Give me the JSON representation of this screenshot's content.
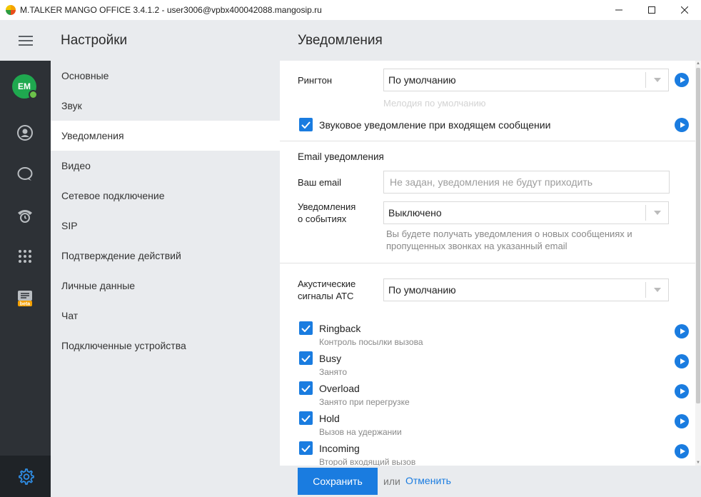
{
  "window": {
    "title": "M.TALKER MANGO OFFICE 3.4.1.2 - user3006@vpbx400042088.mangosip.ru"
  },
  "rail": {
    "avatar_initials": "EM",
    "beta_badge": "beta"
  },
  "nav": {
    "title": "Настройки",
    "items": [
      {
        "label": "Основные"
      },
      {
        "label": "Звук"
      },
      {
        "label": "Уведомления"
      },
      {
        "label": "Видео"
      },
      {
        "label": "Сетевое подключение"
      },
      {
        "label": "SIP"
      },
      {
        "label": "Подтверждение действий"
      },
      {
        "label": "Личные данные"
      },
      {
        "label": "Чат"
      },
      {
        "label": "Подключенные устройства"
      }
    ],
    "active_index": 2
  },
  "main": {
    "title": "Уведомления",
    "ringtone": {
      "label": "Рингтон",
      "value": "По умолчанию",
      "hint": "Мелодия по умолчанию"
    },
    "sound_notification": {
      "label": "Звуковое уведомление при входящем сообщении",
      "checked": true
    },
    "email": {
      "section_title": "Email уведомления",
      "email_label": "Ваш email",
      "email_placeholder": "Не задан, уведомления не будут приходить",
      "events_label_line1": "Уведомления",
      "events_label_line2": "о событиях",
      "events_value": "Выключено",
      "events_hint_line1": "Вы будете получать уведомления о новых сообщениях и",
      "events_hint_line2": "пропущенных звонках на указанный email"
    },
    "acoustic": {
      "label_line1": "Акустические",
      "label_line2": "сигналы АТС",
      "value": "По умолчанию",
      "signals": [
        {
          "name": "Ringback",
          "desc": "Контроль посылки вызова",
          "checked": true
        },
        {
          "name": "Busy",
          "desc": "Занято",
          "checked": true
        },
        {
          "name": "Overload",
          "desc": "Занято при перегрузке",
          "checked": true
        },
        {
          "name": "Hold",
          "desc": "Вызов на удержании",
          "checked": true
        },
        {
          "name": "Incoming",
          "desc": "Второй входящий вызов",
          "checked": true
        }
      ]
    }
  },
  "footer": {
    "save_label": "Сохранить",
    "or_text": "или",
    "cancel_label": "Отменить"
  },
  "colors": {
    "accent": "#1a7ce0",
    "rail_bg": "#2d3136",
    "panel_bg": "#e9ebee",
    "avatar_bg": "#1fa84f",
    "beta_badge": "#f4a000"
  },
  "icons": {
    "rail": [
      "menu-icon",
      "contacts-icon",
      "chat-icon",
      "call-history-icon",
      "dialpad-icon",
      "news-icon",
      "settings-icon"
    ]
  }
}
